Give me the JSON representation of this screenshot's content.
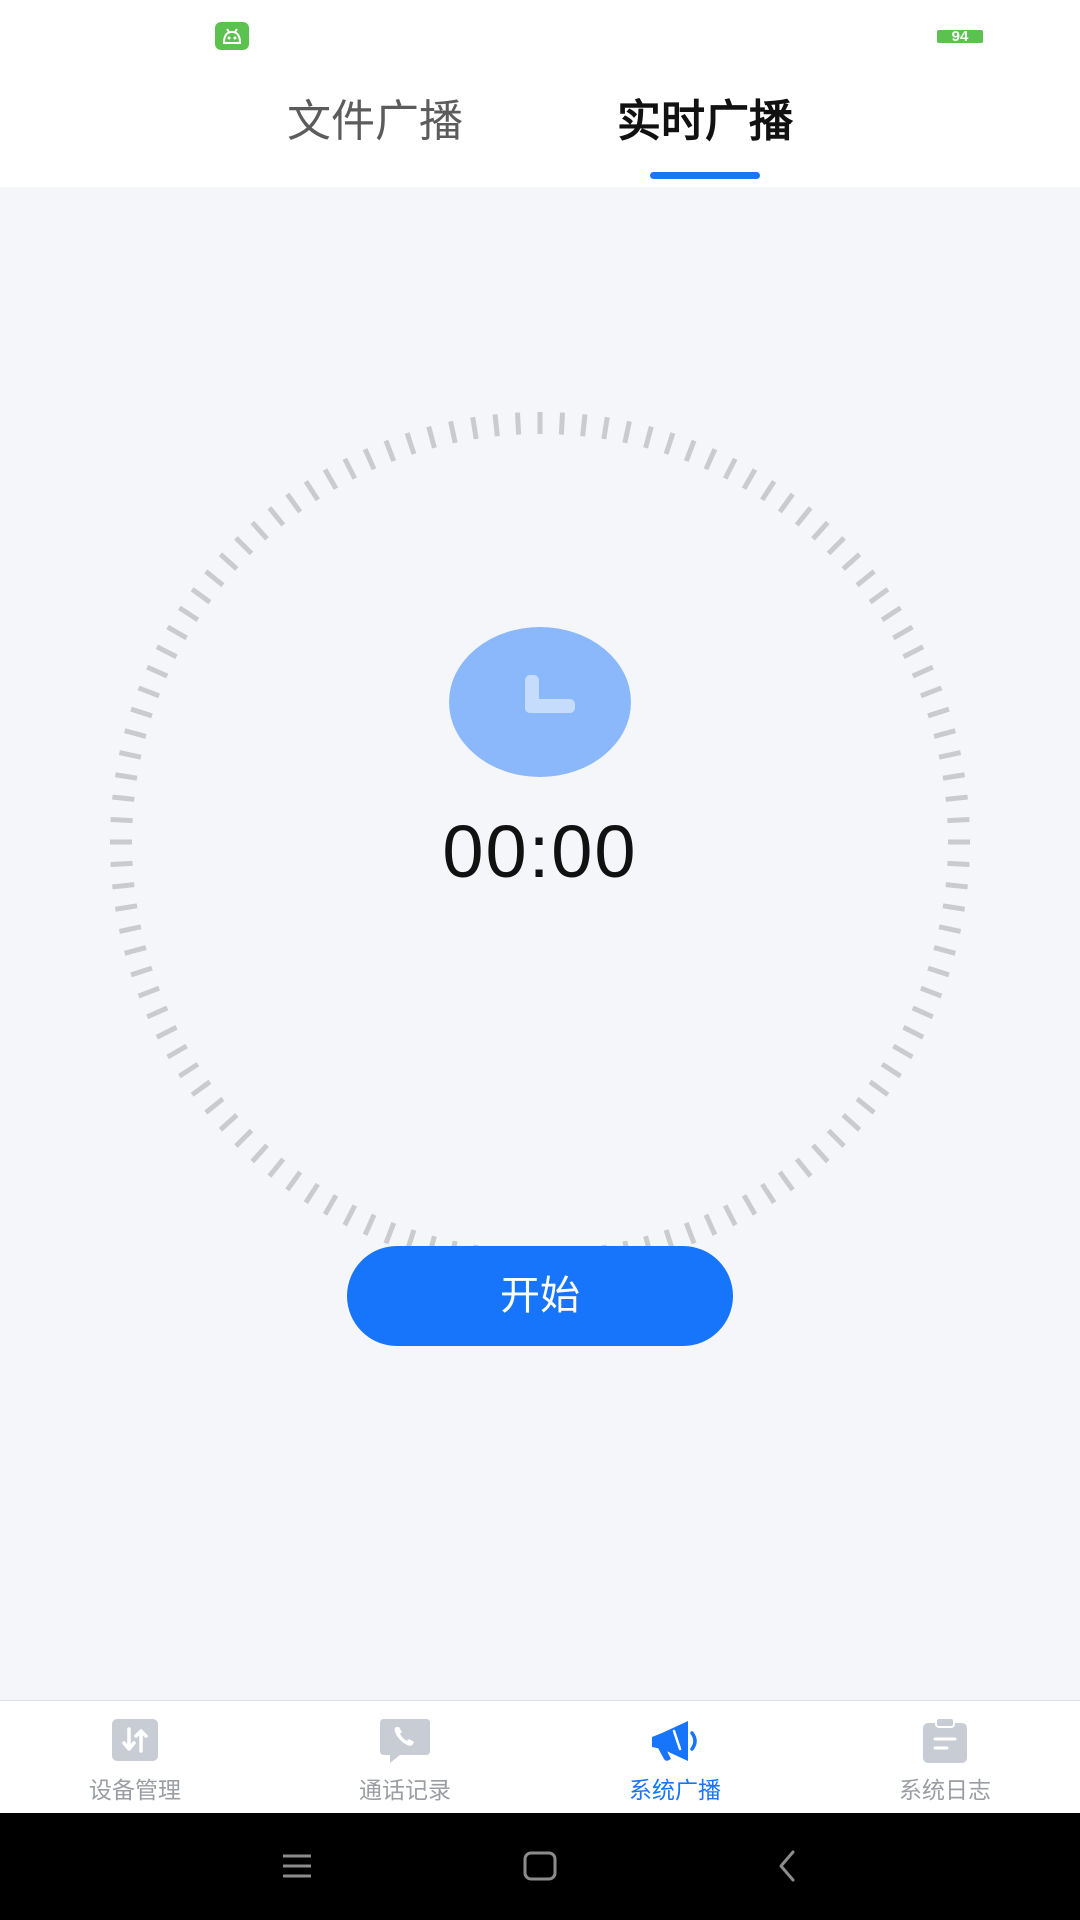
{
  "status_bar": {
    "battery_level": "94",
    "app_icon": "android-robot-icon",
    "accent": "#5bc24f"
  },
  "tabs": [
    {
      "label": "文件广播",
      "active": false
    },
    {
      "label": "实时广播",
      "active": true
    }
  ],
  "timer": {
    "display": "00:00",
    "icon": "clock-icon"
  },
  "start_button": {
    "label": "开始"
  },
  "bottom_nav": [
    {
      "label": "设备管理",
      "icon": "transfer-arrows-icon",
      "active": false
    },
    {
      "label": "通话记录",
      "icon": "phone-icon",
      "active": false
    },
    {
      "label": "系统广播",
      "icon": "megaphone-icon",
      "active": true
    },
    {
      "label": "系统日志",
      "icon": "clipboard-icon",
      "active": false
    }
  ],
  "system_nav": {
    "icons": [
      "menu-icon",
      "home-icon",
      "back-icon"
    ]
  },
  "colors": {
    "accent": "#1775fb",
    "background": "#f4f6fa",
    "tick": "#c9cbcf",
    "clock_badge": "#8ab8fb",
    "inactive_nav": "#c8ccd4"
  }
}
